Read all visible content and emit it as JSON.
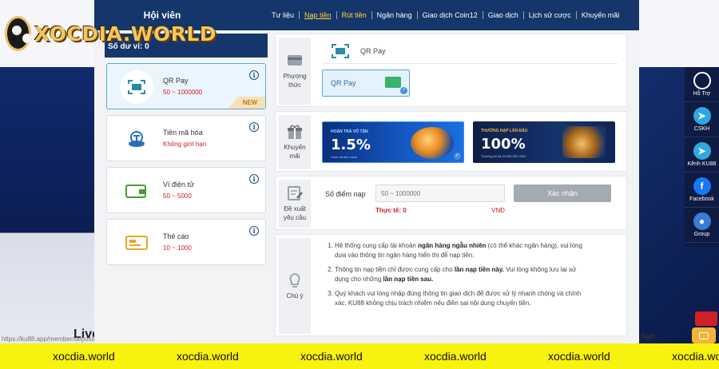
{
  "logo": {
    "text": "XOCDIA.WORLD"
  },
  "background": {
    "live_text": "Live",
    "url_text": "https://ku88.app/member/deposit",
    "ngo_text": "Ngô"
  },
  "modal": {
    "title": "Hội viên",
    "nav": [
      "Tư liệu",
      "Nạp tiền",
      "Rút tiền",
      "Ngân hàng",
      "Giao dịch Coin12",
      "Giao dịch",
      "Lịch sử cược",
      "Khuyến mãi"
    ],
    "balance_label": "Số dư ví: 0"
  },
  "methods": [
    {
      "name": "QR Pay",
      "range": "50 ~ 1000000",
      "badge": "NEW"
    },
    {
      "name": "Tiền mã hóa",
      "range": "Không giới hạn"
    },
    {
      "name": "Ví điện tử",
      "range": "50 ~ 5000"
    },
    {
      "name": "Thẻ cào",
      "range": "10 ~ 1000"
    }
  ],
  "payment_section": {
    "label": "Phương thức",
    "selected_title": "QR Pay",
    "chip_label": "QR Pay"
  },
  "promo_section": {
    "label": "Khuyến mãi",
    "promos": [
      {
        "small": "HOÀN TRẢ VÔ TẬN",
        "big": "1.5%",
        "tiny": "Hoàn trả liên cược"
      },
      {
        "small": "THƯỞNG NẠP LẦN ĐẦU",
        "big": "100%",
        "tiny": "Thưởng tối đa 20.000.000 VND"
      }
    ]
  },
  "amount_section": {
    "label": "Đề xuất yêu cầu",
    "amount_label": "Số điểm nạp",
    "placeholder": "50 ~ 1000000",
    "actual": "Thực tế: 0",
    "currency": "VNĐ",
    "submit": "Xác nhận"
  },
  "notes_section": {
    "label": "Chú ý",
    "items": [
      {
        "pre": "Hệ thống cung cấp tài khoản ",
        "bold": "ngân hàng ngẫu nhiên",
        "post": " (có thể khác ngân hàng), vui lòng dựa vào thông tin ngân hàng hiển thị để nạp tiền."
      },
      {
        "pre": "Thông tin nạp tiền chỉ được cung cấp cho ",
        "bold": "lần nạp tiền này.",
        "mid": " Vui lòng không lưu lại sử dụng cho những ",
        "bold2": "lần nạp tiền sau.",
        "post": ""
      },
      {
        "pre": "Quý khách vui lòng nhập đúng thông tin giao dịch để được xử lý nhanh chóng và chính xác. KU88 không chịu trách nhiệm nếu điền sai nội dung chuyển tiền.",
        "bold": "",
        "post": ""
      }
    ]
  },
  "sidebar": [
    {
      "label": "Hỗ Trợ",
      "icon": "headset-icon",
      "glyph": ""
    },
    {
      "label": "CSKH",
      "icon": "telegram-icon",
      "glyph": "➤"
    },
    {
      "label": "Kênh KU88",
      "icon": "telegram-icon",
      "glyph": "➤"
    },
    {
      "label": "Facebook",
      "icon": "facebook-icon",
      "glyph": "f"
    },
    {
      "label": "Group",
      "icon": "group-icon",
      "glyph": "●"
    }
  ],
  "watermark": "xocdia.world",
  "colors": {
    "header": "#14366b",
    "accent_red": "#d0202b",
    "nav_active": "#ffd73e",
    "watermark_bar": "#f7f20f"
  }
}
